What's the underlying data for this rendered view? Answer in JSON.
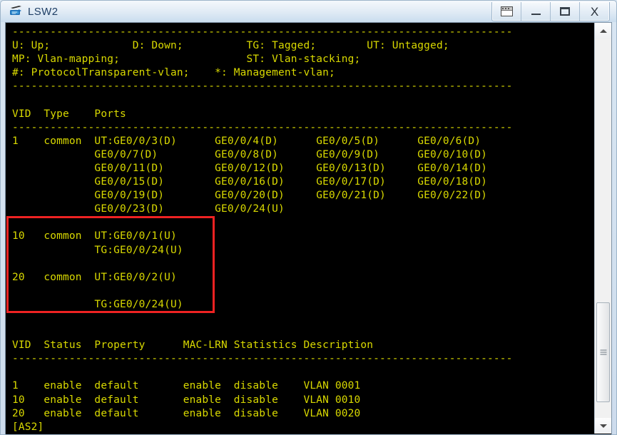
{
  "window": {
    "title": "LSW2",
    "icon": "switch-icon",
    "buttons": [
      {
        "name": "palette",
        "label": ""
      },
      {
        "name": "minimize",
        "label": ""
      },
      {
        "name": "maximize",
        "label": ""
      },
      {
        "name": "close",
        "label": "X"
      }
    ]
  },
  "colors": {
    "terminal_bg": "#000000",
    "terminal_fg": "#d9d900",
    "annotation": "#ee2222",
    "titlebar_text": "#1f3f66"
  },
  "terminal": {
    "legend": {
      "separator_top": "-------------------------------------------------------------------------------",
      "line1": "U: Up;             D: Down;          TG: Tagged;        UT: Untagged;",
      "line2": "MP: Vlan-mapping;                    ST: Vlan-stacking;",
      "line3": "#: ProtocolTransparent-vlan;    *: Management-vlan;",
      "separator_bottom": "-------------------------------------------------------------------------------"
    },
    "ports_table": {
      "header": "VID  Type    Ports",
      "separator": "-------------------------------------------------------------------------------",
      "rows": [
        "1    common  UT:GE0/0/3(D)      GE0/0/4(D)      GE0/0/5(D)      GE0/0/6(D)",
        "             GE0/0/7(D)         GE0/0/8(D)      GE0/0/9(D)      GE0/0/10(D)",
        "             GE0/0/11(D)        GE0/0/12(D)     GE0/0/13(D)     GE0/0/14(D)",
        "             GE0/0/15(D)        GE0/0/16(D)     GE0/0/17(D)     GE0/0/18(D)",
        "             GE0/0/19(D)        GE0/0/20(D)     GE0/0/21(D)     GE0/0/22(D)",
        "             GE0/0/23(D)        GE0/0/24(U)",
        "",
        "10   common  UT:GE0/0/1(U)",
        "             TG:GE0/0/24(U)",
        "",
        "20   common  UT:GE0/0/2(U)",
        "",
        "             TG:GE0/0/24(U)",
        "",
        ""
      ]
    },
    "status_table": {
      "header": "VID  Status  Property      MAC-LRN Statistics Description",
      "separator": "-------------------------------------------------------------------------------",
      "blank": "",
      "rows": [
        "1    enable  default       enable  disable    VLAN 0001",
        "10   enable  default       enable  disable    VLAN 0010",
        "20   enable  default       enable  disable    VLAN 0020"
      ]
    },
    "prompt": "[AS2]"
  },
  "annotation": {
    "label": "vlan-10-20-highlight"
  },
  "scrollbar": {
    "up_arrow": "▲",
    "down_arrow": "▼"
  }
}
